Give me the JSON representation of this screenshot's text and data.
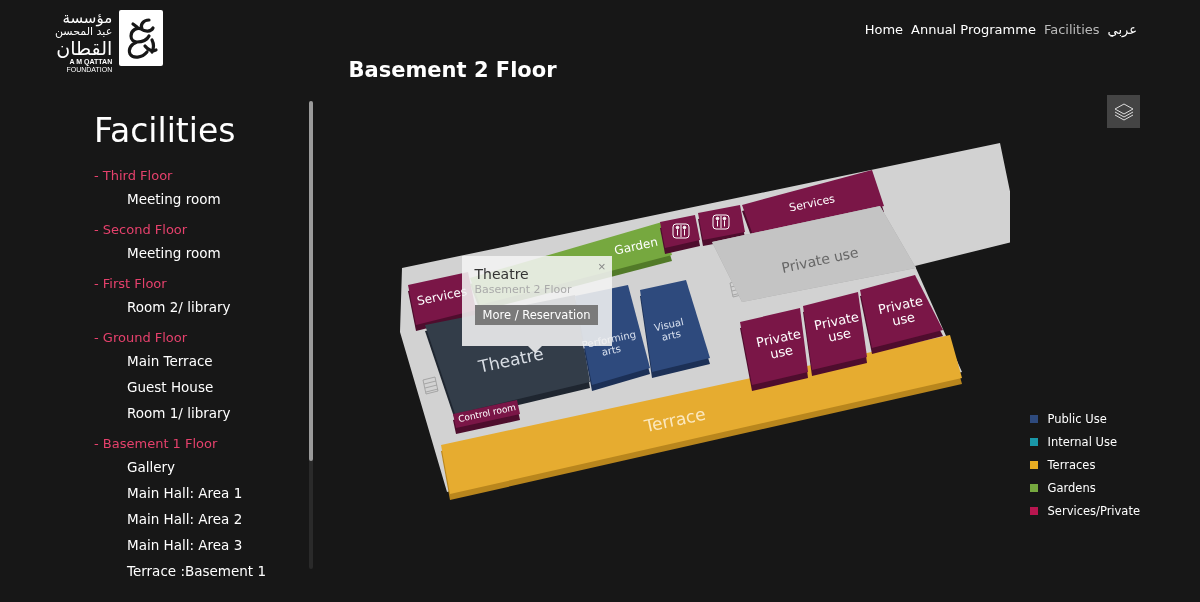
{
  "logo": {
    "arabic_lines": [
      "مؤسسة",
      "عبد المحسن",
      "القطان"
    ],
    "english_lines": [
      "A M QATTAN",
      "FOUNDATION"
    ]
  },
  "nav": [
    {
      "label": "Home",
      "selected": false
    },
    {
      "label": "Annual Programme",
      "selected": false
    },
    {
      "label": "Facilities",
      "selected": true
    },
    {
      "label": "عربي",
      "selected": false
    }
  ],
  "page_title": "Basement 2 Floor",
  "sidebar": {
    "title": "Facilities",
    "floors": [
      {
        "label": "- Third Floor",
        "children": [
          {
            "label": "Meeting room"
          }
        ]
      },
      {
        "label": "- Second Floor",
        "children": [
          {
            "label": "Meeting room"
          }
        ]
      },
      {
        "label": "- First Floor",
        "children": [
          {
            "label": "Room 2/ library"
          }
        ]
      },
      {
        "label": "- Ground Floor",
        "children": [
          {
            "label": "Main Terrace"
          },
          {
            "label": "Guest House"
          },
          {
            "label": "Room 1/ library"
          }
        ]
      },
      {
        "label": "- Basement 1 Floor",
        "children": [
          {
            "label": "Gallery"
          },
          {
            "label": "Main Hall: Area 1"
          },
          {
            "label": "Main Hall: Area 2"
          },
          {
            "label": "Main Hall: Area 3"
          },
          {
            "label": "Terrace :Basement 1"
          }
        ]
      }
    ]
  },
  "map": {
    "rooms": [
      {
        "label": "Services",
        "kind": "services"
      },
      {
        "label": "Garden",
        "kind": "garden"
      },
      {
        "kind": "restroom"
      },
      {
        "kind": "restroom"
      },
      {
        "label": "Services",
        "kind": "services"
      },
      {
        "label": "Private use",
        "kind": "private_area"
      },
      {
        "label": "Theatre",
        "kind": "theatre"
      },
      {
        "label": "Performing arts",
        "kind": "public"
      },
      {
        "label": "Visual arts",
        "kind": "public"
      },
      {
        "label": "Control room",
        "kind": "services"
      },
      {
        "label": "Terrace",
        "kind": "terrace"
      },
      {
        "label": "Private use",
        "kind": "services"
      },
      {
        "label": "Private use",
        "kind": "services"
      },
      {
        "label": "Private use",
        "kind": "services"
      }
    ],
    "tooltip": {
      "title": "Theatre",
      "subtitle": "Basement 2 Floor",
      "button": "More / Reservation",
      "close": "×"
    },
    "legend": [
      {
        "label": "Public Use",
        "color": "#2e4a7d"
      },
      {
        "label": "Internal Use",
        "color": "#1a97a8"
      },
      {
        "label": "Terraces",
        "color": "#e6ac22"
      },
      {
        "label": "Gardens",
        "color": "#76a83f"
      },
      {
        "label": "Services/Private",
        "color": "#b8164f"
      }
    ]
  }
}
